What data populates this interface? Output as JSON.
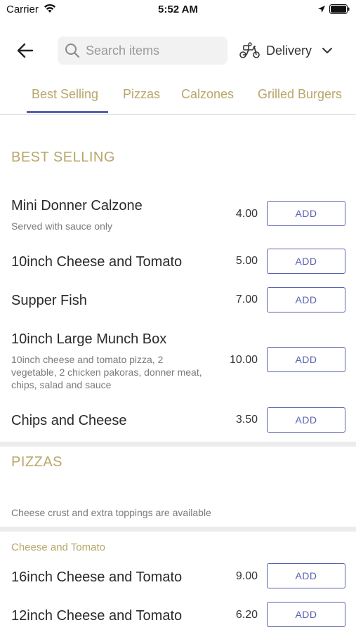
{
  "status_bar": {
    "carrier": "Carrier",
    "time": "5:52 AM"
  },
  "header": {
    "search_placeholder": "Search items",
    "delivery_label": "Delivery"
  },
  "tabs": [
    {
      "label": "Best Selling",
      "active": true
    },
    {
      "label": "Pizzas",
      "active": false
    },
    {
      "label": "Calzones",
      "active": false
    },
    {
      "label": "Grilled Burgers",
      "active": false
    }
  ],
  "sections": {
    "best_selling": {
      "title": "BEST SELLING",
      "items": [
        {
          "name": "Mini Donner Calzone",
          "description": "Served with sauce only",
          "price": "4.00",
          "add_label": "ADD"
        },
        {
          "name": "10inch Cheese and Tomato",
          "description": "",
          "price": "5.00",
          "add_label": "ADD"
        },
        {
          "name": "Supper Fish",
          "description": "",
          "price": "7.00",
          "add_label": "ADD"
        },
        {
          "name": "10inch Large Munch Box",
          "description": "10inch cheese and tomato pizza, 2 vegetable, 2 chicken pakoras, donner meat, chips, salad and sauce",
          "price": "10.00",
          "add_label": "ADD"
        },
        {
          "name": "Chips and Cheese",
          "description": "",
          "price": "3.50",
          "add_label": "ADD"
        }
      ]
    },
    "pizzas": {
      "title": "PIZZAS",
      "note": "Cheese crust and extra toppings are available",
      "subsection_title": "Cheese and Tomato",
      "items": [
        {
          "name": "16inch Cheese and Tomato",
          "price": "9.00",
          "add_label": "ADD"
        },
        {
          "name": "12inch Cheese and Tomato",
          "price": "6.20",
          "add_label": "ADD"
        }
      ]
    }
  },
  "colors": {
    "accent_gold": "#b8a66a",
    "accent_indigo": "#5862b0"
  }
}
